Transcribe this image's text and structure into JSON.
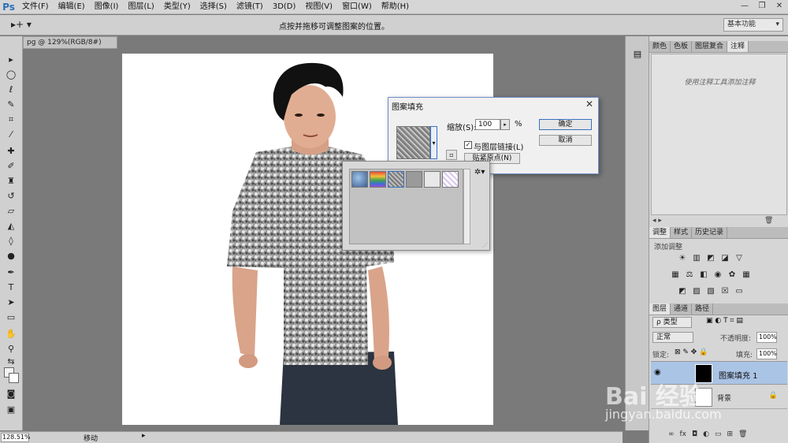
{
  "app": {
    "logo": "Ps"
  },
  "menu": [
    "文件(F)",
    "编辑(E)",
    "图像(I)",
    "图层(L)",
    "类型(Y)",
    "选择(S)",
    "滤镜(T)",
    "3D(D)",
    "视图(V)",
    "窗口(W)",
    "帮助(H)"
  ],
  "window_controls": {
    "minimize": "—",
    "restore": "❐",
    "close": "✕"
  },
  "options_bar": {
    "tool_glyph": "▸+ ▾",
    "hint": "点按并拖移可调整图案的位置。",
    "workspace": "基本功能"
  },
  "document": {
    "tab_title": "pg @ 129%(RGB/8#)"
  },
  "status": {
    "zoom": "128.51%",
    "text": "移动",
    "arrow": "▸"
  },
  "dialog": {
    "title": "图案填充",
    "close": "✕",
    "scale_label": "缩放(S):",
    "scale_value": "100",
    "scale_arrow": "▸",
    "scale_unit": "%",
    "link_checked": "✓",
    "link_label": "与图层链接(L)",
    "snap_button": "贴紧原点(N)",
    "ok_button": "确定",
    "cancel_button": "取消",
    "dropdown_arrow": "▾"
  },
  "picker": {
    "gear": "✲▾",
    "grip": "⋰"
  },
  "panels": {
    "top_tabs": [
      "颜色",
      "色板",
      "图层复合",
      "注释"
    ],
    "notes_hint": "使用注释工具添加注释",
    "notes_footer_left": "◂ ▸",
    "notes_footer_right": "🗑",
    "adjust_tabs": [
      "调整",
      "样式",
      "历史记录"
    ],
    "adjust_title": "添加调整",
    "layers_tabs": [
      "图层",
      "通道",
      "路径"
    ],
    "kind_label": "ρ 类型",
    "blend_mode": "正常",
    "opacity_label": "不透明度:",
    "opacity_value": "100%",
    "lock_label": "锁定:",
    "fill_label": "填充:",
    "fill_value": "100%",
    "layers": [
      {
        "name": "图案填充 1"
      },
      {
        "name": "背景"
      }
    ],
    "footer_icons": [
      "∞",
      "fx",
      "◘",
      "◐",
      "▭",
      "⊞",
      "🗑"
    ]
  },
  "watermark": {
    "logo": "Bai 经验",
    "url": "jingyan.baidu.com"
  },
  "colors": {
    "selected_layer": "#aac4e6",
    "dialog_border": "#6d8fc7",
    "ps_blue": "#2d6fb8"
  }
}
